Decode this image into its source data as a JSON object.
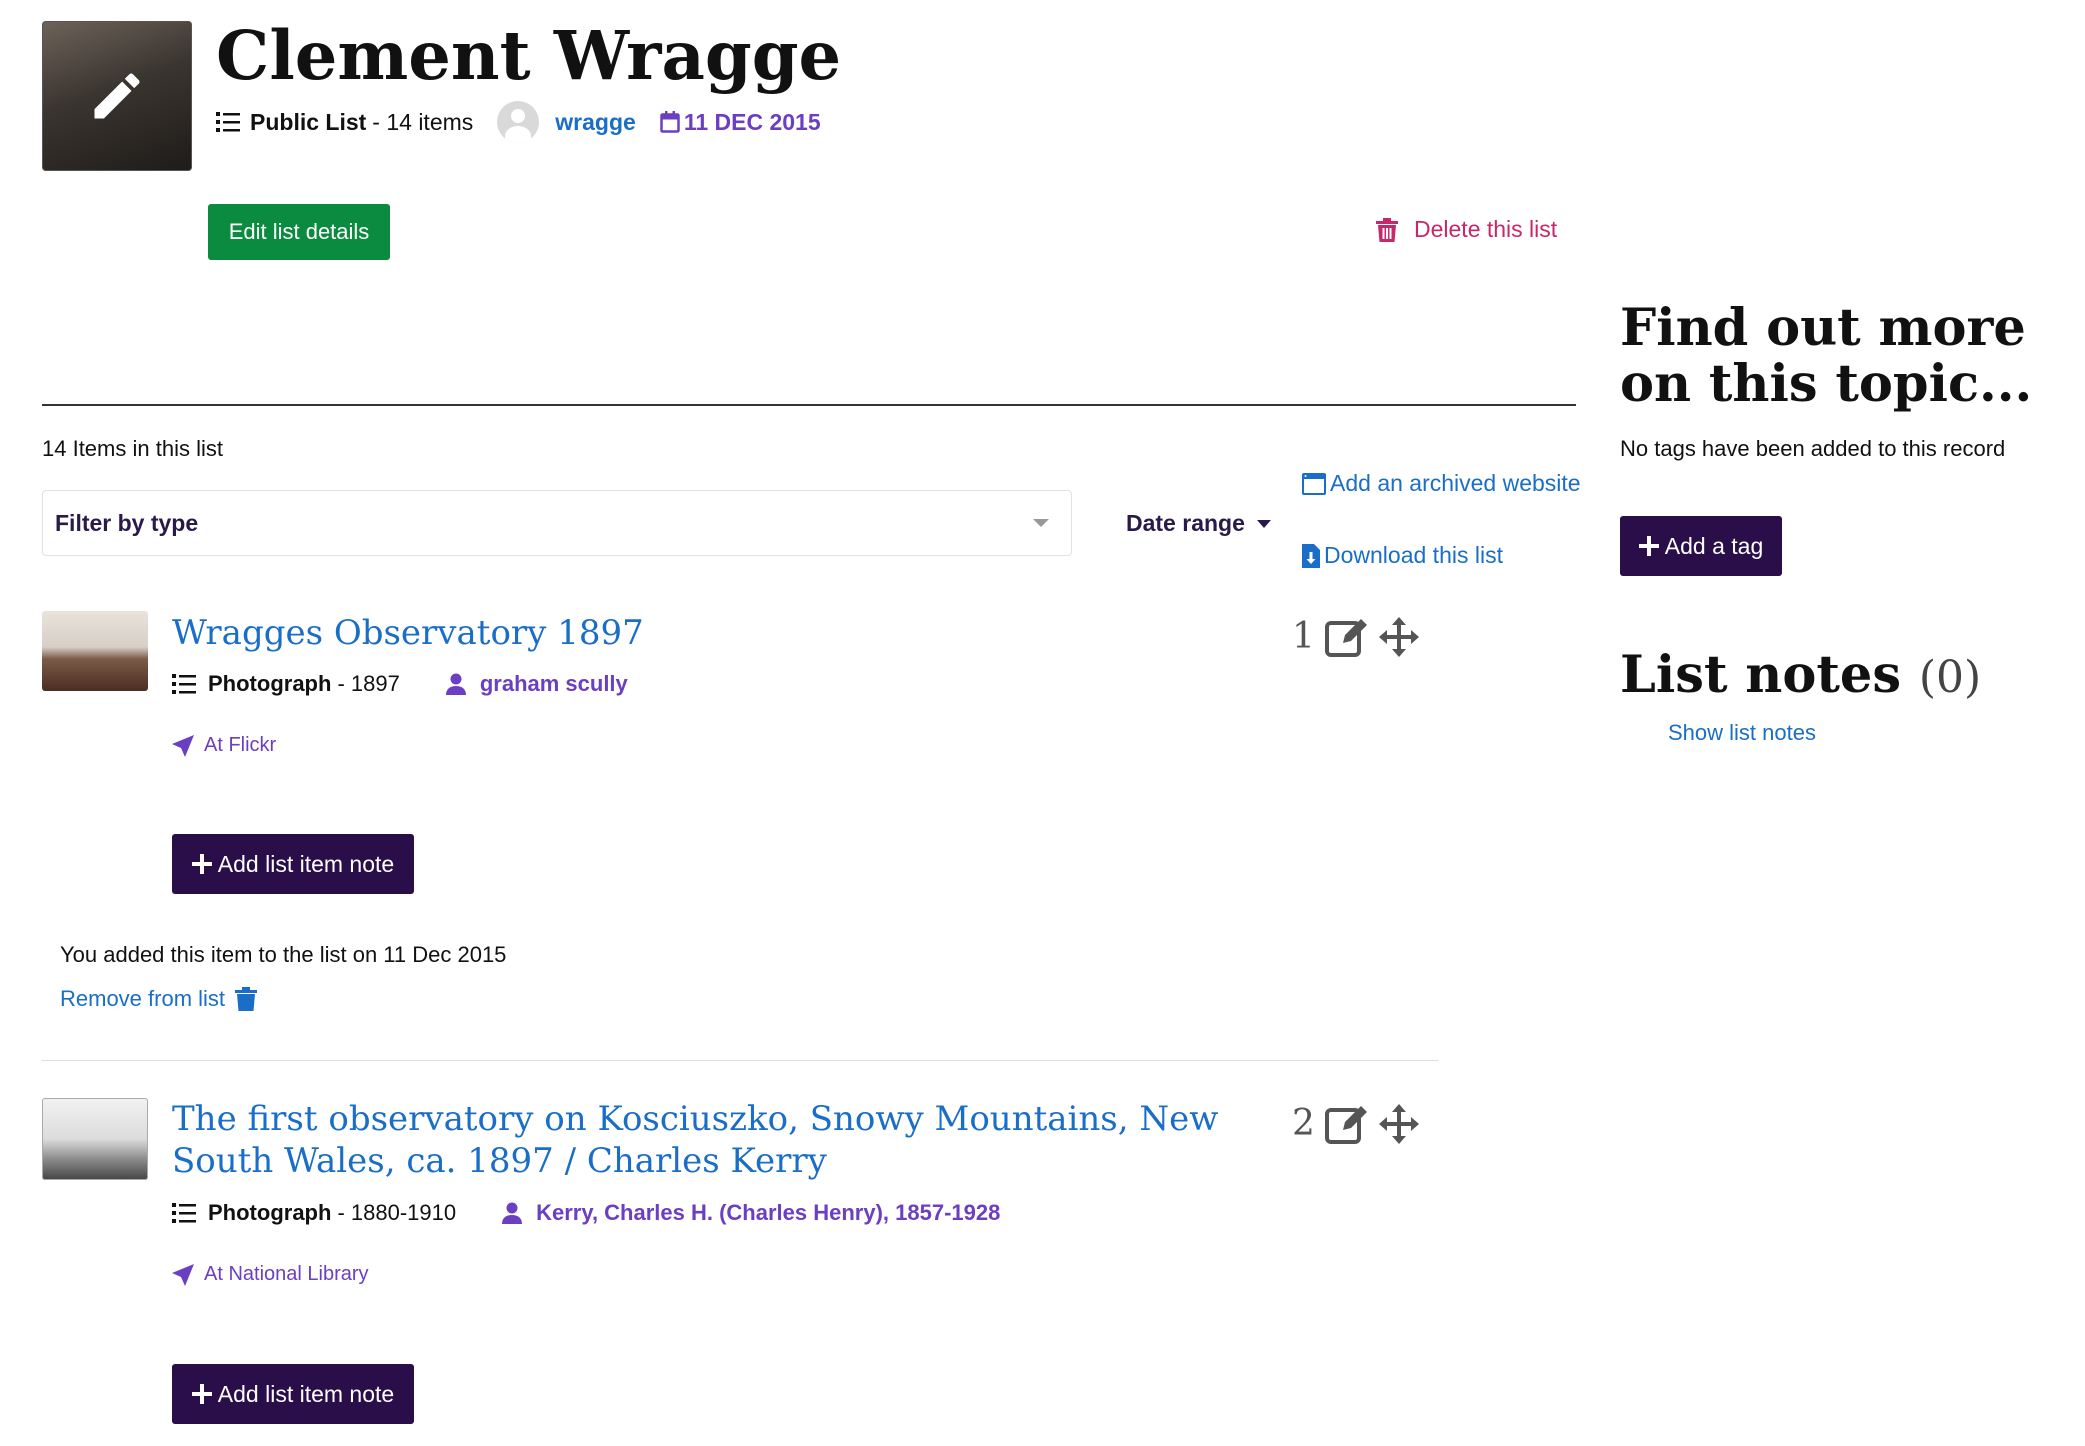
{
  "list": {
    "title": "Clement Wragge",
    "visibility": "Public List",
    "item_count_text": "- 14 items",
    "owner": "wragge",
    "date": "11 DEC 2015",
    "edit_label": "Edit list details",
    "delete_label": "Delete this list"
  },
  "toolbar": {
    "items_count": "14 Items in this list",
    "filter_placeholder": "Filter by type",
    "date_range": "Date range",
    "add_archived": "Add an archived website",
    "download": "Download this list"
  },
  "items": [
    {
      "number": "1",
      "title": "Wragges Observatory 1897",
      "type": "Photograph",
      "date": "- 1897",
      "author": "graham scully",
      "source": "At Flickr",
      "note_button": "Add list item note",
      "added_text": "You added this item to the list on 11 Dec 2015",
      "remove_label": "Remove from list"
    },
    {
      "number": "2",
      "title": "The first observatory on Kosciuszko, Snowy Mountains, New South Wales, ca. 1897 / Charles Kerry",
      "type": "Photograph",
      "date": "- 1880-1910",
      "author": "Kerry, Charles H. (Charles Henry), 1857-1928",
      "source": "At National Library",
      "note_button": "Add list item note"
    }
  ],
  "sidebar": {
    "find_heading": "Find out more on this topic...",
    "no_tags": "No tags have been added to this record",
    "add_tag": "Add a tag",
    "notes_heading": "List notes",
    "notes_count": "(0)",
    "show_notes": "Show list notes"
  },
  "colors": {
    "green": "#0a8b3f",
    "dark_purple": "#2a0e4a",
    "link_blue": "#1a6ec8",
    "purple": "#6b3fc2",
    "delete_pink": "#c8286a"
  },
  "icons": [
    "pencil-icon",
    "list-icon",
    "user-icon",
    "calendar-icon",
    "trash-icon",
    "browser-icon",
    "download-file-icon",
    "location-arrow-icon",
    "plus-icon",
    "edit-icon",
    "move-icon"
  ]
}
